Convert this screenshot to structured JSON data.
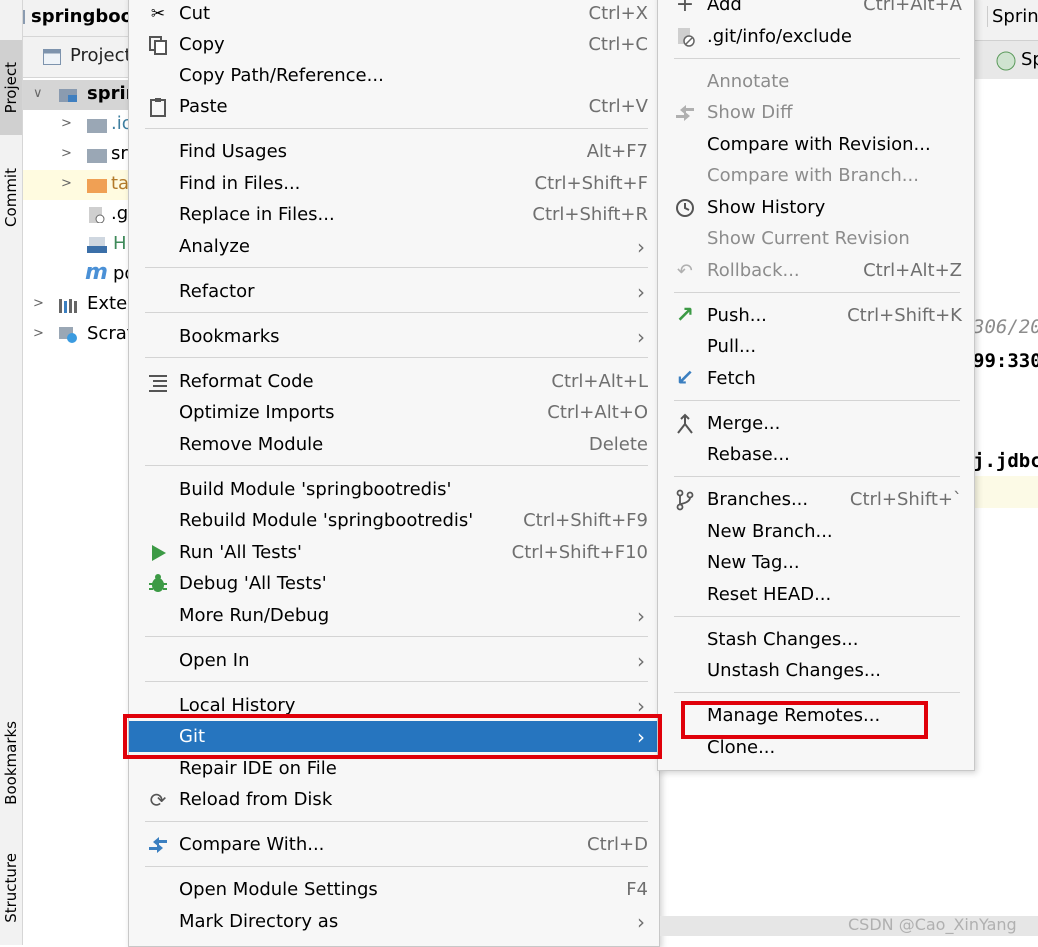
{
  "tool_strip": {
    "project_tab": "Project",
    "commit_tab": "Commit",
    "bookmarks_tab": "Bookmarks",
    "structure_tab": "Structure"
  },
  "project_window": {
    "title": "springboot",
    "header_label": "Project",
    "tree": [
      {
        "label": "sprin",
        "expanded": true
      },
      {
        "label": ".io",
        "icon": "folder-icon"
      },
      {
        "label": "sr",
        "icon": "folder-icon"
      },
      {
        "label": "ta",
        "icon": "orange-folder-icon"
      },
      {
        "label": ".g",
        "icon": "gitignore-file-icon"
      },
      {
        "label": "H",
        "icon": "markdown-file-icon"
      },
      {
        "label": "po",
        "icon": "maven-file-icon"
      },
      {
        "label": "Exter",
        "icon": "libraries-icon"
      },
      {
        "label": "Scrat",
        "icon": "scratches-icon"
      }
    ]
  },
  "editor": {
    "tab_top": "Spring",
    "tab_second": "Sp",
    "code_lines": [
      "306/20",
      "99:330",
      "j.jdbc"
    ]
  },
  "main_menu": {
    "items": [
      {
        "label": "Cut",
        "shortcut": "Ctrl+X",
        "icon": "scissors-icon"
      },
      {
        "label": "Copy",
        "shortcut": "Ctrl+C",
        "icon": "copy-icon"
      },
      {
        "label": "Copy Path/Reference...",
        "shortcut": ""
      },
      {
        "label": "Paste",
        "shortcut": "Ctrl+V",
        "icon": "paste-icon"
      },
      {
        "label": "Find Usages",
        "shortcut": "Alt+F7"
      },
      {
        "label": "Find in Files...",
        "shortcut": "Ctrl+Shift+F"
      },
      {
        "label": "Replace in Files...",
        "shortcut": "Ctrl+Shift+R"
      },
      {
        "label": "Analyze",
        "submenu": true
      },
      {
        "label": "Refactor",
        "submenu": true
      },
      {
        "label": "Bookmarks",
        "submenu": true
      },
      {
        "label": "Reformat Code",
        "shortcut": "Ctrl+Alt+L",
        "icon": "reformat-icon"
      },
      {
        "label": "Optimize Imports",
        "shortcut": "Ctrl+Alt+O"
      },
      {
        "label": "Remove Module",
        "shortcut": "Delete"
      },
      {
        "label": "Build Module 'springbootredis'",
        "shortcut": ""
      },
      {
        "label": "Rebuild Module 'springbootredis'",
        "shortcut": "Ctrl+Shift+F9"
      },
      {
        "label": "Run 'All Tests'",
        "shortcut": "Ctrl+Shift+F10",
        "icon": "run-icon"
      },
      {
        "label": "Debug 'All Tests'",
        "shortcut": "",
        "icon": "debug-icon"
      },
      {
        "label": "More Run/Debug",
        "submenu": true
      },
      {
        "label": "Open In",
        "submenu": true
      },
      {
        "label": "Local History",
        "submenu": true
      },
      {
        "label": "Git",
        "submenu": true,
        "selected": true
      },
      {
        "label": "Repair IDE on File",
        "shortcut": ""
      },
      {
        "label": "Reload from Disk",
        "shortcut": "",
        "icon": "reload-icon"
      },
      {
        "label": "Compare With...",
        "shortcut": "Ctrl+D",
        "icon": "compare-icon"
      },
      {
        "label": "Open Module Settings",
        "shortcut": "F4"
      },
      {
        "label": "Mark Directory as",
        "submenu": true
      }
    ]
  },
  "git_menu": {
    "items": [
      {
        "label": "Add",
        "shortcut": "Ctrl+Alt+A",
        "icon": "plus-icon"
      },
      {
        "label": ".git/info/exclude",
        "shortcut": "",
        "icon": "gitignore-file-icon"
      },
      {
        "label": "Annotate",
        "disabled": true
      },
      {
        "label": "Show Diff",
        "disabled": true,
        "icon": "diff-icon"
      },
      {
        "label": "Compare with Revision..."
      },
      {
        "label": "Compare with Branch...",
        "disabled": true
      },
      {
        "label": "Show History",
        "icon": "history-icon"
      },
      {
        "label": "Show Current Revision",
        "disabled": true
      },
      {
        "label": "Rollback...",
        "shortcut": "Ctrl+Alt+Z",
        "disabled": true,
        "icon": "rollback-icon"
      },
      {
        "label": "Push...",
        "shortcut": "Ctrl+Shift+K",
        "icon": "push-icon"
      },
      {
        "label": "Pull..."
      },
      {
        "label": "Fetch",
        "icon": "fetch-icon"
      },
      {
        "label": "Merge...",
        "icon": "merge-icon"
      },
      {
        "label": "Rebase..."
      },
      {
        "label": "Branches...",
        "shortcut": "Ctrl+Shift+`",
        "icon": "branch-icon"
      },
      {
        "label": "New Branch..."
      },
      {
        "label": "New Tag..."
      },
      {
        "label": "Reset HEAD..."
      },
      {
        "label": "Stash Changes..."
      },
      {
        "label": "Unstash Changes..."
      },
      {
        "label": "Manage Remotes..."
      },
      {
        "label": "Clone..."
      }
    ]
  },
  "watermark": "CSDN @Cao_XinYang",
  "colors": {
    "selection": "#2675bf",
    "highlight_box": "#e0000a",
    "menu_bg": "#f7f7f7"
  }
}
